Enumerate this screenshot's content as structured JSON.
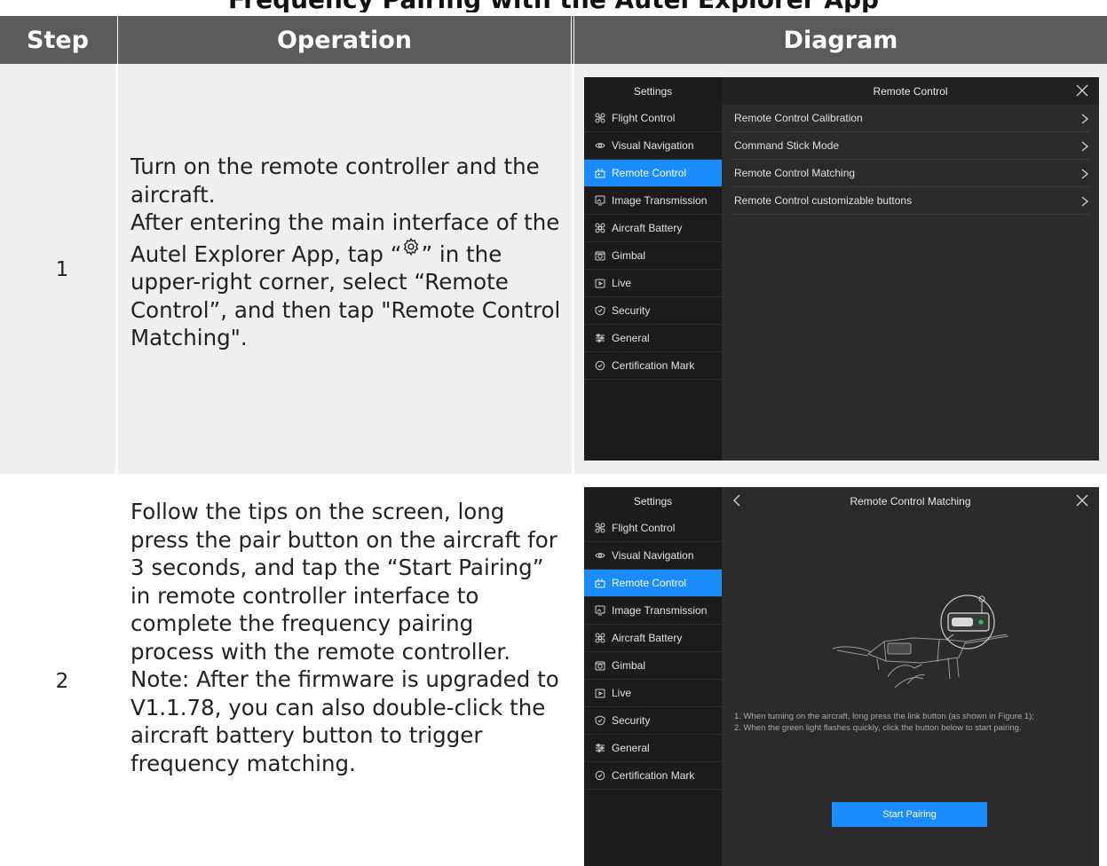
{
  "document": {
    "title": "Frequency Pairing with the Autel Explorer App"
  },
  "table": {
    "headers": {
      "step": "Step",
      "operation": "Operation",
      "diagram": "Diagram"
    },
    "rows": [
      {
        "step": "1",
        "operation": {
          "line1": "Turn on the remote controller and the aircraft.",
          "line2_before_icon": "After entering the main interface of the Autel Explorer App, tap “",
          "icon": "gear-icon",
          "line2_after_icon": "” in the upper-right corner, select “Remote Control”, and then tap \"Remote Control Matching\"."
        }
      },
      {
        "step": "2",
        "operation": {
          "line1": "Follow the tips on the screen, long press the pair button on the aircraft for 3 seconds, and tap the “Start Pairing” in remote controller interface to complete the frequency pairing process with the remote controller.",
          "line2": "Note: After the firmware is upgraded to V1.1.78, you can also double-click the aircraft battery button to trigger frequency matching."
        }
      }
    ]
  },
  "app": {
    "sidebar": {
      "title": "Settings",
      "items": [
        {
          "label": "Flight Control",
          "icon": "drone-icon"
        },
        {
          "label": "Visual Navigation",
          "icon": "eye-icon"
        },
        {
          "label": "Remote Control",
          "icon": "controller-icon",
          "active": true
        },
        {
          "label": "Image Transmission",
          "icon": "image-icon"
        },
        {
          "label": "Aircraft Battery",
          "icon": "drone-battery-icon"
        },
        {
          "label": "Gimbal",
          "icon": "camera-icon"
        },
        {
          "label": "Live",
          "icon": "live-icon"
        },
        {
          "label": "Security",
          "icon": "shield-icon"
        },
        {
          "label": "General",
          "icon": "sliders-icon"
        },
        {
          "label": "Certification Mark",
          "icon": "badge-icon"
        }
      ]
    },
    "screen1": {
      "header": "Remote Control",
      "rows": [
        "Remote Control Calibration",
        "Command Stick Mode",
        "Remote Control Matching",
        "Remote Control customizable buttons"
      ]
    },
    "screen2": {
      "header": "Remote Control Matching",
      "tip1": "1. When turning on the aircraft, long press the link button (as shown in Figure 1);",
      "tip2": "2. When the green light flashes quickly, click the button below to start pairing.",
      "button": "Start Pairing"
    },
    "colors": {
      "accent": "#1a8cff",
      "sidebar_bg": "#1c1c1c",
      "panel_bg": "#2b2b2b",
      "header_bg": "#5b5b5b",
      "row_shade": "#efefef",
      "indicator_green": "#22c55e"
    }
  }
}
